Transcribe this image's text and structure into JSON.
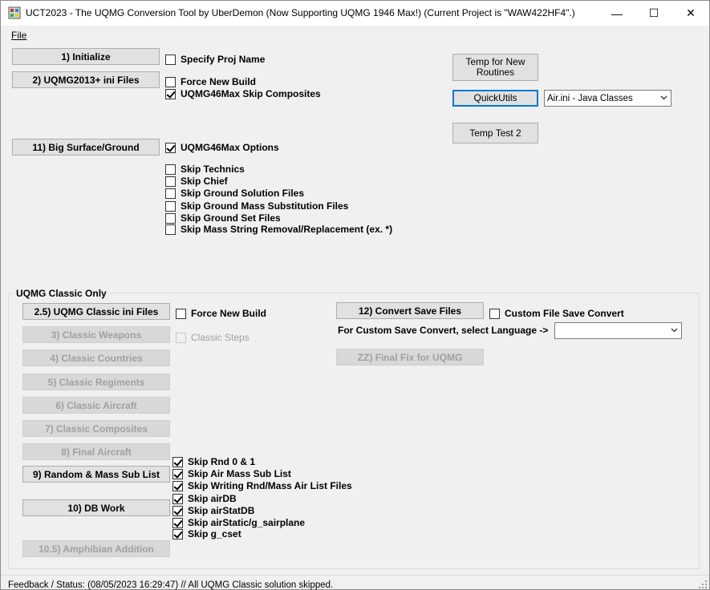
{
  "window": {
    "title": "UCT2023 - The UQMG Conversion Tool by UberDemon (Now Supporting UQMG 1946 Max!) (Current Project is \"WAW422HF4\".)",
    "minimize": "—",
    "maximize": "☐",
    "close": "✕"
  },
  "menu": {
    "file": "File"
  },
  "top_buttons": {
    "initialize": "1) Initialize",
    "ini_files": "2) UQMG2013+ ini Files",
    "big_surface": "11) Big Surface/Ground"
  },
  "top_checks": {
    "specify_proj": {
      "label": "Specify Proj Name",
      "checked": false
    },
    "force_new_build": {
      "label": "Force New Build",
      "checked": false
    },
    "skip_composites": {
      "label": "UQMG46Max Skip Composites",
      "checked": true
    },
    "max_options": {
      "label": "UQMG46Max Options",
      "checked": true
    },
    "skip_technics": {
      "label": "Skip Technics",
      "checked": false
    },
    "skip_chief": {
      "label": "Skip Chief",
      "checked": false
    },
    "skip_ground_solution": {
      "label": "Skip Ground Solution Files",
      "checked": false
    },
    "skip_ground_mass": {
      "label": "Skip Ground Mass Substitution Files",
      "checked": false
    },
    "skip_ground_set": {
      "label": "Skip Ground Set Files",
      "checked": false
    },
    "skip_mass_string": {
      "label": "Skip Mass String Removal/Replacement (ex. *)",
      "checked": false
    }
  },
  "right_panel": {
    "temp_routines": "Temp for New Routines",
    "quick_utils": "QuickUtils",
    "combo_value": "Air.ini - Java Classes",
    "temp_test": "Temp Test 2"
  },
  "classic": {
    "group_title": "UQMG Classic Only",
    "buttons": {
      "classic_ini": "2.5) UQMG Classic ini Files",
      "weapons": "3) Classic Weapons",
      "countries": "4) Classic Countries",
      "regiments": "5) Classic Regiments",
      "aircraft": "6) Classic Aircraft",
      "composites": "7) Classic Composites",
      "final_aircraft": "8) Final Aircraft",
      "random_mass": "9) Random & Mass Sub List",
      "db_work": "10) DB Work",
      "amphibian": "10.5) Amphibian Addition",
      "convert_save": "12) Convert Save Files",
      "final_fix": "ZZ) Final Fix for UQMG"
    },
    "checks": {
      "force_new_build": {
        "label": "Force New Build",
        "checked": false
      },
      "classic_steps": {
        "label": "Classic Steps",
        "checked": false
      },
      "custom_save": {
        "label": "Custom File Save Convert",
        "checked": false
      },
      "skip_rnd": {
        "label": "Skip Rnd 0 & 1",
        "checked": true
      },
      "skip_air_mass": {
        "label": "Skip Air Mass Sub List",
        "checked": true
      },
      "skip_writing": {
        "label": "Skip Writing Rnd/Mass Air List Files",
        "checked": true
      },
      "skip_airdb": {
        "label": "Skip airDB",
        "checked": true
      },
      "skip_airstatdb": {
        "label": "Skip airStatDB",
        "checked": true
      },
      "skip_airstatic": {
        "label": "Skip airStatic/g_sairplane",
        "checked": true
      },
      "skip_gcset": {
        "label": "Skip g_cset",
        "checked": true
      }
    },
    "language_label": "For Custom Save Convert, select Language ->",
    "language_value": ""
  },
  "status": {
    "text": "Feedback / Status:  (08/05/2023 16:29:47) // All UQMG Classic solution skipped."
  }
}
